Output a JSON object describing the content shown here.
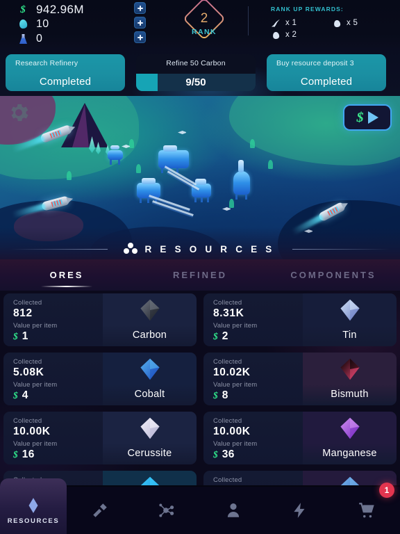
{
  "hud": {
    "resources": [
      {
        "icon": "money-icon",
        "value": "942.96M"
      },
      {
        "icon": "gem-icon",
        "value": "10"
      },
      {
        "icon": "flask-icon",
        "value": "0"
      }
    ],
    "add_buttons": [
      "add-money-button",
      "add-gem-button",
      "add-research-button"
    ],
    "rank": {
      "number": "2",
      "label": "RANK"
    },
    "rewards": {
      "title": "RANK UP REWARDS:",
      "items": [
        {
          "icon": "rocket-icon",
          "text": "x 1"
        },
        {
          "icon": "gem-icon",
          "text": "x 5"
        },
        {
          "icon": "gem-icon",
          "text": "x 2"
        }
      ]
    }
  },
  "quests": [
    {
      "label": "Research Refinery",
      "status": "Completed",
      "type": "completed"
    },
    {
      "label": "Refine 50 Carbon",
      "progress_text": "9/50",
      "current": 9,
      "goal": 50,
      "type": "progress"
    },
    {
      "label": "Buy resource deposit 3",
      "status": "Completed",
      "type": "completed"
    }
  ],
  "scene": {
    "settings_icon": "gear-icon",
    "boost_button": {
      "currency_icon": "dollar-icon",
      "play_icon": "play-icon"
    }
  },
  "section": {
    "icon": "resources-cluster-icon",
    "title": "R E S O U R C E S"
  },
  "tabs": [
    {
      "label": "ORES",
      "active": true
    },
    {
      "label": "REFINED",
      "active": false
    },
    {
      "label": "COMPONENTS",
      "active": false
    }
  ],
  "labels": {
    "collected": "Collected",
    "value_per_item": "Value per item",
    "currency_symbol": "$"
  },
  "items": [
    {
      "name": "Carbon",
      "collected": "812",
      "value": "1",
      "color_a": "#6e7480",
      "color_b": "#20232c",
      "tile": "#1a2240"
    },
    {
      "name": "Tin",
      "collected": "8.31K",
      "value": "2",
      "color_a": "#cfe0f5",
      "color_b": "#6d7fc4",
      "tile": "#161d3a"
    },
    {
      "name": "Cobalt",
      "collected": "5.08K",
      "value": "4",
      "color_a": "#57b2ef",
      "color_b": "#1c4fc0",
      "tile": "#15203f"
    },
    {
      "name": "Bismuth",
      "collected": "10.02K",
      "value": "8",
      "color_a": "#f5b councils",
      "color_b": "#e0446f",
      "tile": "#2b1f3c"
    },
    {
      "name": "Cerussite",
      "collected": "10.00K",
      "value": "16",
      "color_a": "#f2f0fa",
      "color_b": "#b9b6d4",
      "tile": "#1b2342"
    },
    {
      "name": "Manganese",
      "collected": "10.00K",
      "value": "36",
      "color_a": "#d08ef0",
      "color_b": "#7a2ec4",
      "tile": "#211a3e"
    },
    {
      "name": "",
      "collected": "Collected",
      "value": "",
      "color_a": "#3ad0ff",
      "color_b": "#1b7fd0",
      "tile": "#10304a"
    },
    {
      "name": "",
      "collected": "Collected",
      "value": "",
      "color_a": "#7ab9ef",
      "color_b": "#2e5fb8",
      "tile": "#241a3c"
    }
  ],
  "nav": {
    "badge": "1",
    "items": [
      {
        "icon": "resources-icon",
        "label": "RESOURCES",
        "active": true
      },
      {
        "icon": "hammer-icon",
        "label": "",
        "active": false
      },
      {
        "icon": "molecule-icon",
        "label": "",
        "active": false
      },
      {
        "icon": "person-icon",
        "label": "",
        "active": false
      },
      {
        "icon": "bolt-icon",
        "label": "",
        "active": false
      },
      {
        "icon": "cart-icon",
        "label": "",
        "active": false
      }
    ]
  }
}
